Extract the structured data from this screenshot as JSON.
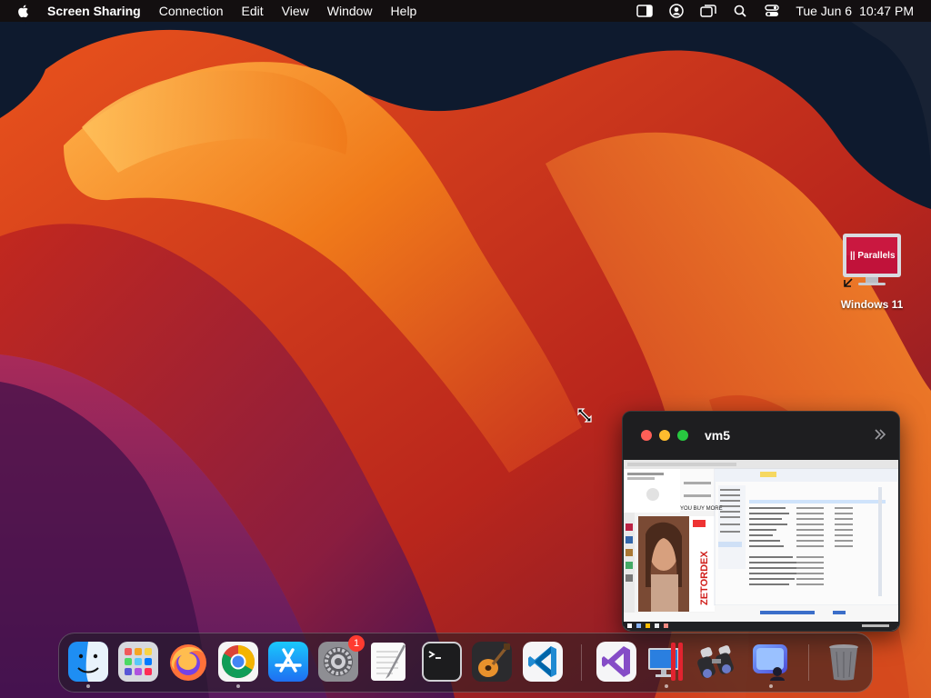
{
  "menubar": {
    "app_name": "Screen Sharing",
    "menus": [
      "Connection",
      "Edit",
      "View",
      "Window",
      "Help"
    ],
    "status_icons": [
      "sidebar-toggle-icon",
      "user-account-icon",
      "screen-mirror-icon",
      "search-icon",
      "control-center-icon"
    ],
    "date": "Tue Jun 6",
    "time": "10:47 PM"
  },
  "desktop": {
    "icon_label": "Windows 11",
    "icon_logo_text": "|| Parallels"
  },
  "vm_window": {
    "title": "vm5",
    "screen_text": "YOU BUY MORE"
  },
  "dock": {
    "apps": [
      {
        "name": "finder",
        "running": true
      },
      {
        "name": "launchpad",
        "running": false
      },
      {
        "name": "firefox",
        "running": false
      },
      {
        "name": "chrome",
        "running": true
      },
      {
        "name": "app-store",
        "running": false
      },
      {
        "name": "system-settings",
        "running": false,
        "badge": "1"
      },
      {
        "name": "textedit",
        "running": false
      },
      {
        "name": "terminal",
        "running": false
      },
      {
        "name": "garageband",
        "running": false
      },
      {
        "name": "vscode",
        "running": false
      },
      {
        "name": "visual-studio",
        "running": false
      },
      {
        "name": "parallels-desktop",
        "running": true
      },
      {
        "name": "screen-sharing-binoculars",
        "running": false
      },
      {
        "name": "screen-sharing",
        "running": true
      },
      {
        "name": "trash",
        "running": false
      }
    ]
  },
  "colors": {
    "wallpaper_orange": "#f07a1a",
    "wallpaper_red": "#c8321e",
    "wallpaper_purple": "#7a1e5a",
    "wallpaper_navy": "#0e1a2e"
  }
}
